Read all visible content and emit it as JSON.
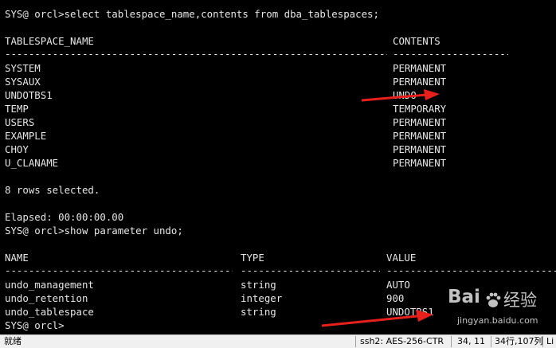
{
  "terminal": {
    "query1": "SYS@ orcl>select tablespace_name,contents from dba_tablespaces;",
    "headers1": {
      "name": "TABLESPACE_NAME",
      "contents": "CONTENTS"
    },
    "rows1": [
      {
        "name": "SYSTEM",
        "contents": "PERMANENT"
      },
      {
        "name": "SYSAUX",
        "contents": "PERMANENT"
      },
      {
        "name": "UNDOTBS1",
        "contents": "UNDO"
      },
      {
        "name": "TEMP",
        "contents": "TEMPORARY"
      },
      {
        "name": "USERS",
        "contents": "PERMANENT"
      },
      {
        "name": "EXAMPLE",
        "contents": "PERMANENT"
      },
      {
        "name": "CHOY",
        "contents": "PERMANENT"
      },
      {
        "name": "U_CLANAME",
        "contents": "PERMANENT"
      }
    ],
    "rows_selected": "8 rows selected.",
    "elapsed": "Elapsed: 00:00:00.00",
    "query2": "SYS@ orcl>show parameter undo;",
    "headers2": {
      "name": "NAME",
      "type": "TYPE",
      "value": "VALUE"
    },
    "rows2": [
      {
        "name": "undo_management",
        "type": "string",
        "value": "AUTO"
      },
      {
        "name": "undo_retention",
        "type": "integer",
        "value": "900"
      },
      {
        "name": "undo_tablespace",
        "type": "string",
        "value": "UNDOTBS1"
      }
    ],
    "prompt": "SYS@ orcl>"
  },
  "arrow_color": "#e8201c",
  "watermark": {
    "logo": "Bai",
    "brand_cn": "经验",
    "url": "jingyan.baidu.com"
  },
  "statusbar": {
    "ready": "就绪",
    "connection": "ssh2: AES-256-CTR",
    "cursor": "34, 11",
    "size": "34行,107列",
    "tail": "Li"
  }
}
